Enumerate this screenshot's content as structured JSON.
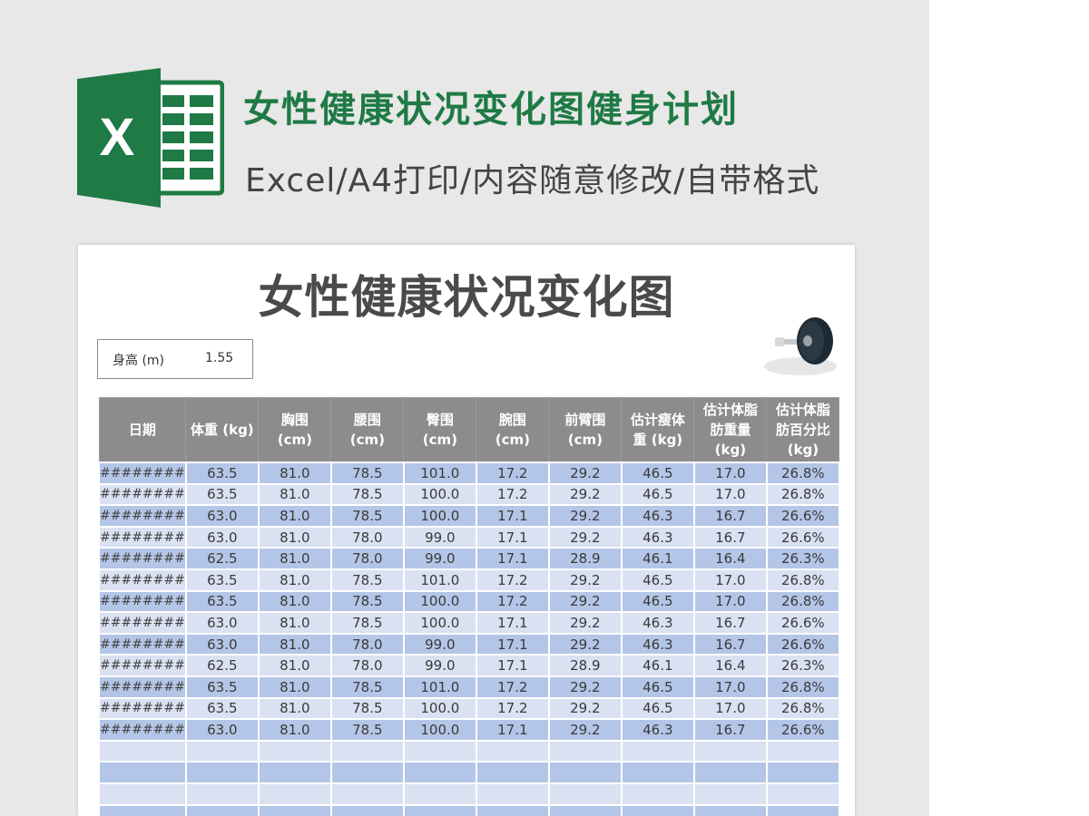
{
  "header": {
    "title": "女性健康状况变化图健身计划",
    "subtitle": "Excel/A4打印/内容随意修改/自带格式"
  },
  "logo": {
    "letter": "X",
    "color": "#1f7a45"
  },
  "sheet": {
    "title": "女性健康状况变化图",
    "height_label": "身高 (m)",
    "height_value": "1.55",
    "columns": [
      [
        "日期"
      ],
      [
        "体重 (kg)"
      ],
      [
        "胸围",
        "(cm)"
      ],
      [
        "腰围",
        "(cm)"
      ],
      [
        "臀围",
        "(cm)"
      ],
      [
        "腕围",
        "(cm)"
      ],
      [
        "前臂围",
        "(cm)"
      ],
      [
        "估计瘦体",
        "重 (kg)"
      ],
      [
        "估计体脂",
        "肪重量",
        "(kg)"
      ],
      [
        "估计体脂",
        "肪百分比",
        "(kg)"
      ]
    ],
    "rows": [
      [
        "########",
        "63.5",
        "81.0",
        "78.5",
        "101.0",
        "17.2",
        "29.2",
        "46.5",
        "17.0",
        "26.8%"
      ],
      [
        "########",
        "63.5",
        "81.0",
        "78.5",
        "100.0",
        "17.2",
        "29.2",
        "46.5",
        "17.0",
        "26.8%"
      ],
      [
        "########",
        "63.0",
        "81.0",
        "78.5",
        "100.0",
        "17.1",
        "29.2",
        "46.3",
        "16.7",
        "26.6%"
      ],
      [
        "########",
        "63.0",
        "81.0",
        "78.0",
        "99.0",
        "17.1",
        "29.2",
        "46.3",
        "16.7",
        "26.6%"
      ],
      [
        "########",
        "62.5",
        "81.0",
        "78.0",
        "99.0",
        "17.1",
        "28.9",
        "46.1",
        "16.4",
        "26.3%"
      ],
      [
        "########",
        "63.5",
        "81.0",
        "78.5",
        "101.0",
        "17.2",
        "29.2",
        "46.5",
        "17.0",
        "26.8%"
      ],
      [
        "########",
        "63.5",
        "81.0",
        "78.5",
        "100.0",
        "17.2",
        "29.2",
        "46.5",
        "17.0",
        "26.8%"
      ],
      [
        "########",
        "63.0",
        "81.0",
        "78.5",
        "100.0",
        "17.1",
        "29.2",
        "46.3",
        "16.7",
        "26.6%"
      ],
      [
        "########",
        "63.0",
        "81.0",
        "78.0",
        "99.0",
        "17.1",
        "29.2",
        "46.3",
        "16.7",
        "26.6%"
      ],
      [
        "########",
        "62.5",
        "81.0",
        "78.0",
        "99.0",
        "17.1",
        "28.9",
        "46.1",
        "16.4",
        "26.3%"
      ],
      [
        "########",
        "63.5",
        "81.0",
        "78.5",
        "101.0",
        "17.2",
        "29.2",
        "46.5",
        "17.0",
        "26.8%"
      ],
      [
        "########",
        "63.5",
        "81.0",
        "78.5",
        "100.0",
        "17.2",
        "29.2",
        "46.5",
        "17.0",
        "26.8%"
      ],
      [
        "########",
        "63.0",
        "81.0",
        "78.5",
        "100.0",
        "17.1",
        "29.2",
        "46.3",
        "16.7",
        "26.6%"
      ],
      [
        "",
        "",
        "",
        "",
        "",
        "",
        "",
        "",
        "",
        ""
      ],
      [
        "",
        "",
        "",
        "",
        "",
        "",
        "",
        "",
        "",
        ""
      ],
      [
        "",
        "",
        "",
        "",
        "",
        "",
        "",
        "",
        "",
        ""
      ],
      [
        "",
        "",
        "",
        "",
        "",
        "",
        "",
        "",
        "",
        ""
      ],
      [
        "",
        "",
        "",
        "",
        "",
        "",
        "",
        "",
        "",
        ""
      ]
    ]
  }
}
